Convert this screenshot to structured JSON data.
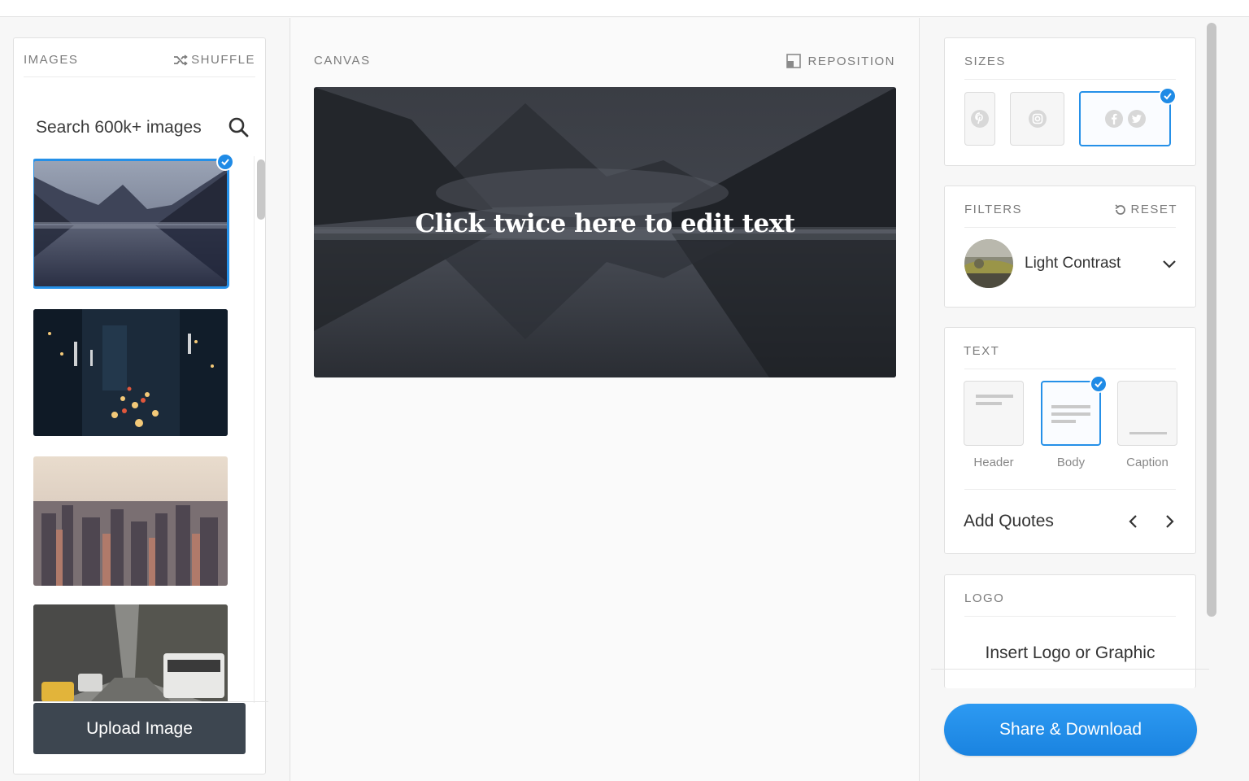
{
  "left": {
    "title": "IMAGES",
    "shuffle_label": "SHUFFLE",
    "search_placeholder": "Search 600k+ images",
    "thumbnails": [
      {
        "subject": "misty mountain lake",
        "selected": true
      },
      {
        "subject": "city traffic at night",
        "selected": false
      },
      {
        "subject": "city skyline aerial",
        "selected": false
      },
      {
        "subject": "city street with taxis",
        "selected": false
      }
    ],
    "upload_label": "Upload Image"
  },
  "canvas": {
    "title": "CANVAS",
    "reposition_label": "REPOSITION",
    "overlay_text": "Click twice here to edit text"
  },
  "sizes": {
    "title": "SIZES",
    "options": [
      {
        "icon": "pinterest-icon",
        "selected": false
      },
      {
        "icon": "instagram-icon",
        "selected": false
      },
      {
        "icon": "facebook-twitter-icon",
        "selected": true
      }
    ]
  },
  "filters": {
    "title": "FILTERS",
    "reset_label": "RESET",
    "selected_filter": "Light Contrast"
  },
  "text": {
    "title": "TEXT",
    "options": [
      {
        "label": "Header",
        "selected": false
      },
      {
        "label": "Body",
        "selected": true
      },
      {
        "label": "Caption",
        "selected": false
      }
    ],
    "add_quotes_label": "Add Quotes"
  },
  "logo": {
    "title": "LOGO",
    "insert_label": "Insert Logo or Graphic"
  },
  "share_label": "Share & Download",
  "colors": {
    "accent": "#2590e8",
    "dark_button": "#3d4650"
  }
}
